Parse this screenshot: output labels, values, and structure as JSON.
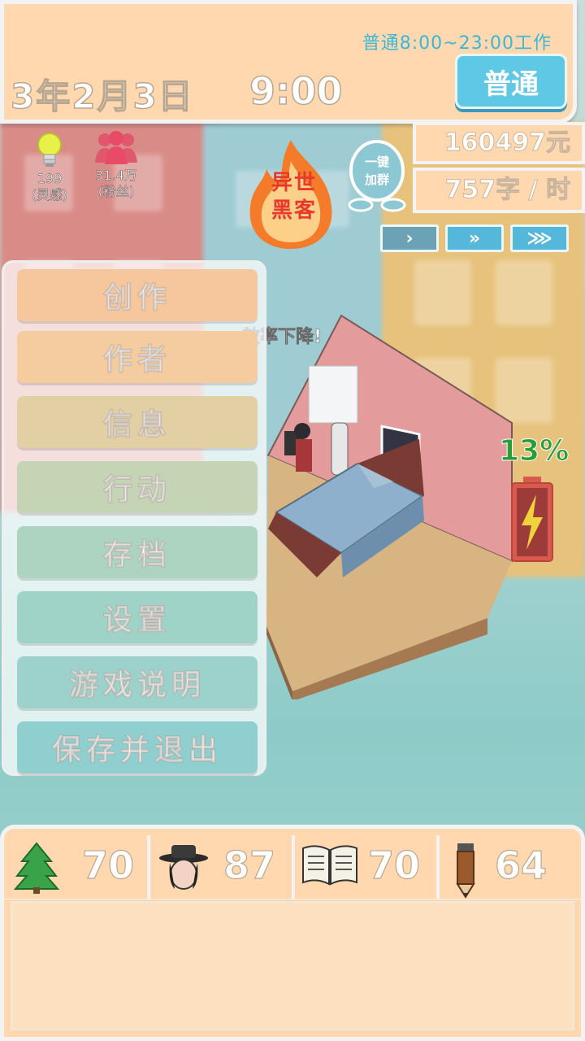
{
  "header": {
    "work_time": "普通8:00~23:00工作",
    "date": "3年2月3日",
    "time": "9:00",
    "mode_button": "普通"
  },
  "stats": {
    "money": "160497元",
    "speed": "757字 / 时",
    "inspiration_value": "199",
    "inspiration_label": "(灵感)",
    "fans_value": "31.4万",
    "fans_label": "(粉丝)"
  },
  "badges": {
    "genre": "异世黑客",
    "genre_line1": "异世",
    "genre_line2": "黑客",
    "group_line1": "一键",
    "group_line2": "加群"
  },
  "speed_controls": [
    "›",
    "»",
    "⋙"
  ],
  "menu": {
    "items": [
      {
        "label": "创作",
        "color": "#f6c79d"
      },
      {
        "label": "作者",
        "color": "#f4cc9f"
      },
      {
        "label": "信息",
        "color": "#e2cfa4"
      },
      {
        "label": "行动",
        "color": "#c5d4b4"
      },
      {
        "label": "存档",
        "color": "#add4c1"
      },
      {
        "label": "设置",
        "color": "#9fd3c7"
      },
      {
        "label": "游戏说明",
        "color": "#9cd2cb"
      },
      {
        "label": "保存并退出",
        "color": "#8fcfcf"
      }
    ]
  },
  "room": {
    "notice": "效率下降!",
    "battery_percent": "13%",
    "battery_level": 0.13
  },
  "attributes": [
    {
      "icon": "tree-icon",
      "value": "70"
    },
    {
      "icon": "hat-person-icon",
      "value": "87"
    },
    {
      "icon": "book-icon",
      "value": "70"
    },
    {
      "icon": "pencil-icon",
      "value": "64"
    }
  ],
  "message_box": ""
}
